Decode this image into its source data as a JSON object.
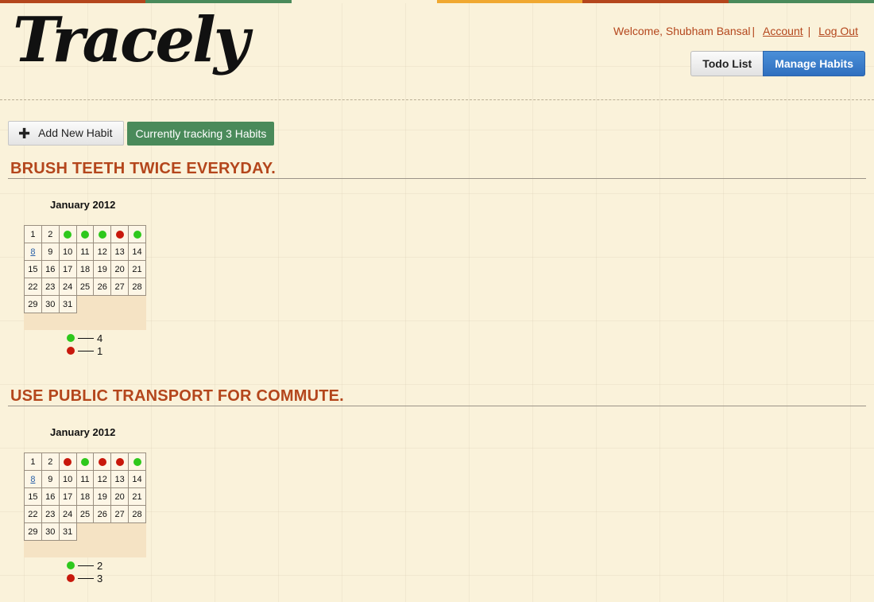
{
  "app": {
    "logo": "Tracely",
    "stripe_colors": [
      "#b4461c",
      "#4a8a5a",
      "#faf2da",
      "#f0a830",
      "#b4461c",
      "#4a8a5a"
    ]
  },
  "user_bar": {
    "welcome": "Welcome, Shubham Bansal",
    "account_label": "Account",
    "logout_label": "Log Out",
    "separator": "|"
  },
  "nav": {
    "todo_label": "Todo List",
    "manage_label": "Manage Habits"
  },
  "actions": {
    "add_label": "Add New Habit",
    "tracking_label": "Currently tracking 3 Habits"
  },
  "colors": {
    "success": "#2ec81c",
    "failure": "#c8180c",
    "accent": "#b4461c"
  },
  "habits": [
    {
      "title": "BRUSH TEETH TWICE EVERYDAY.",
      "month": "January 2012",
      "first_row": [
        "1",
        "2",
        "success",
        "success",
        "success",
        "failure",
        "success"
      ],
      "rows": [
        [
          "8",
          "9",
          "10",
          "11",
          "12",
          "13",
          "14"
        ],
        [
          "15",
          "16",
          "17",
          "18",
          "19",
          "20",
          "21"
        ],
        [
          "22",
          "23",
          "24",
          "25",
          "26",
          "27",
          "28"
        ],
        [
          "29",
          "30",
          "31"
        ]
      ],
      "success_count": "4",
      "failure_count": "1"
    },
    {
      "title": "USE PUBLIC TRANSPORT FOR COMMUTE.",
      "month": "January 2012",
      "first_row": [
        "1",
        "2",
        "failure",
        "success",
        "failure",
        "failure",
        "success"
      ],
      "rows": [
        [
          "8",
          "9",
          "10",
          "11",
          "12",
          "13",
          "14"
        ],
        [
          "15",
          "16",
          "17",
          "18",
          "19",
          "20",
          "21"
        ],
        [
          "22",
          "23",
          "24",
          "25",
          "26",
          "27",
          "28"
        ],
        [
          "29",
          "30",
          "31"
        ]
      ],
      "success_count": "2",
      "failure_count": "3"
    }
  ]
}
